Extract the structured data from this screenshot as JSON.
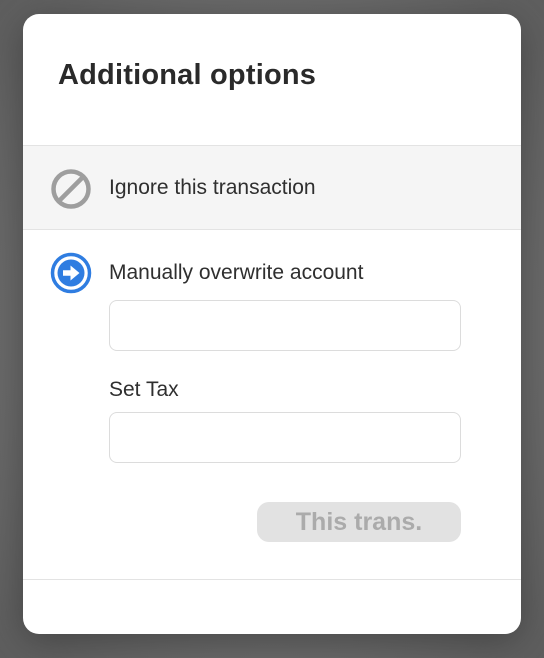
{
  "modal": {
    "title": "Additional options",
    "options": {
      "ignore": {
        "label": "Ignore this transaction",
        "icon": "ban-icon",
        "color": "#9e9e9e"
      },
      "overwrite": {
        "label": "Manually overwrite account",
        "icon": "arrow-right-circle-icon",
        "color": "#2f7de1",
        "account_input_value": "",
        "tax_label": "Set Tax",
        "tax_input_value": "",
        "apply_button_label": "This trans."
      }
    }
  }
}
